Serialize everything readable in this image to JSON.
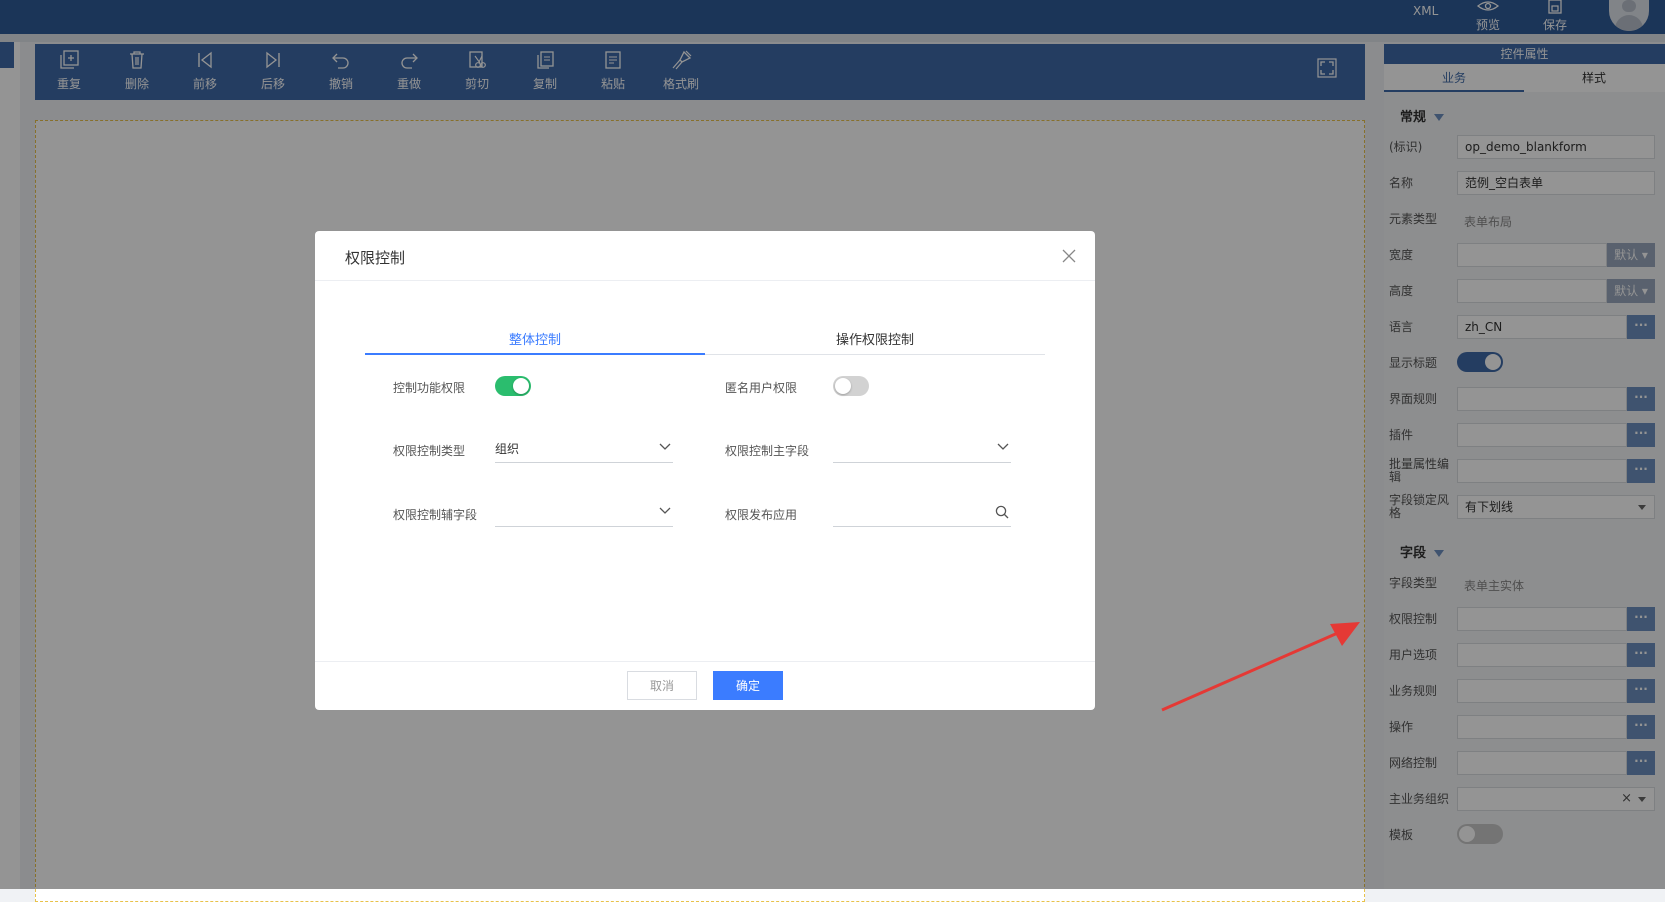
{
  "header": {
    "xml_label": "XML",
    "preview_label": "预览",
    "save_label": "保存"
  },
  "toolbar": {
    "items": [
      {
        "label": "重复",
        "icon": "duplicate-icon"
      },
      {
        "label": "删除",
        "icon": "trash-icon"
      },
      {
        "label": "前移",
        "icon": "move-first-icon"
      },
      {
        "label": "后移",
        "icon": "move-last-icon"
      },
      {
        "label": "撤销",
        "icon": "undo-icon"
      },
      {
        "label": "重做",
        "icon": "redo-icon"
      },
      {
        "label": "剪切",
        "icon": "cut-icon"
      },
      {
        "label": "复制",
        "icon": "copy-icon"
      },
      {
        "label": "粘贴",
        "icon": "paste-icon"
      },
      {
        "label": "格式刷",
        "icon": "format-brush-icon"
      }
    ]
  },
  "panel": {
    "title": "控件属性",
    "tabs": [
      "业务",
      "样式"
    ],
    "section_general": "常规",
    "section_field": "字段",
    "rows": {
      "id_label": "(标识)",
      "id_value": "op_demo_blankform",
      "name_label": "名称",
      "name_value": "范例_空白表单",
      "elem_type_label": "元素类型",
      "elem_type_value": "表单布局",
      "width_label": "宽度",
      "width_default": "默认",
      "height_label": "高度",
      "height_default": "默认",
      "lang_label": "语言",
      "lang_value": "zh_CN",
      "show_title_label": "显示标题",
      "ui_rule_label": "界面规则",
      "plugin_label": "插件",
      "batch_label": "批量属性编辑",
      "lock_style_label": "字段锁定风格",
      "lock_style_value": "有下划线",
      "field_type_label": "字段类型",
      "field_type_value": "表单主实体",
      "perm_label": "权限控制",
      "user_opt_label": "用户选项",
      "biz_rule_label": "业务规则",
      "op_label": "操作",
      "net_label": "网络控制",
      "main_org_label": "主业务组织",
      "template_label": "模板"
    },
    "more": "···",
    "clear": "×"
  },
  "modal": {
    "title": "权限控制",
    "tabs": [
      "整体控制",
      "操作权限控制"
    ],
    "func_perm_label": "控制功能权限",
    "anon_perm_label": "匿名用户权限",
    "perm_type_label": "权限控制类型",
    "perm_type_value": "组织",
    "main_field_label": "权限控制主字段",
    "main_field_value": "",
    "aux_field_label": "权限控制辅字段",
    "aux_field_value": "",
    "publish_app_label": "权限发布应用",
    "publish_app_value": "",
    "cancel_label": "取消",
    "ok_label": "确定"
  }
}
